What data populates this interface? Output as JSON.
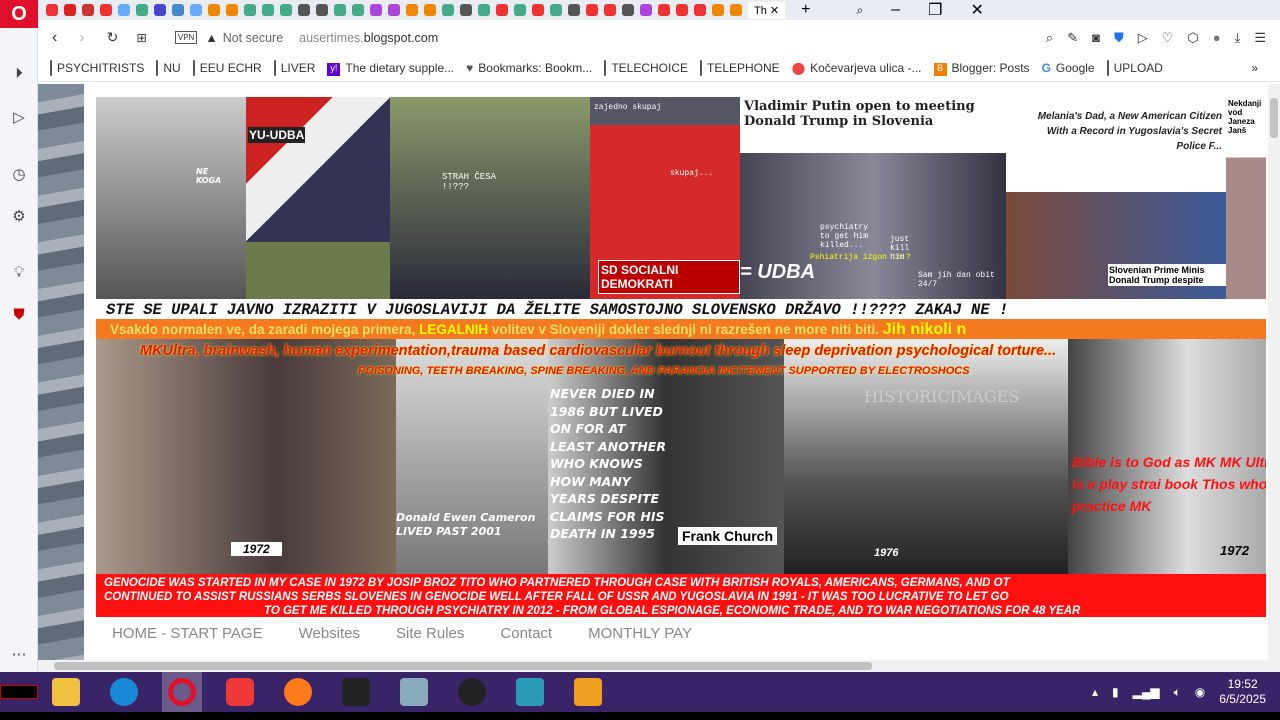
{
  "browser": {
    "url_prefix": "ausertimes.",
    "url_domain": "blogspot.com",
    "vpn": "VPN",
    "security": "Not secure",
    "tab_title": "Th"
  },
  "bookmarks": [
    {
      "label": "PSYCHITRISTS",
      "icon": "folder-icon"
    },
    {
      "label": "NU",
      "icon": "folder-icon"
    },
    {
      "label": "EEU ECHR",
      "icon": "folder-icon"
    },
    {
      "label": "LIVER",
      "icon": "folder-icon"
    },
    {
      "label": "The dietary supple...",
      "icon": "yahoo-icon"
    },
    {
      "label": "Bookmarks: Bookm...",
      "icon": "heart-icon"
    },
    {
      "label": "TELECHOICE",
      "icon": "folder-icon"
    },
    {
      "label": "TELEPHONE",
      "icon": "folder-icon"
    },
    {
      "label": "Kočevarjeva ulica -...",
      "icon": "maps-pin-icon"
    },
    {
      "label": "Blogger: Posts",
      "icon": "blogger-icon"
    },
    {
      "label": "Google",
      "icon": "google-icon"
    },
    {
      "label": "UPLOAD",
      "icon": "folder-icon"
    }
  ],
  "banner": {
    "top_captions": {
      "yu_udba": "YU-UDBA",
      "ne_koga": "NE KOGA",
      "strah": "STRAH ČESA !!???",
      "zajedno": "zajedno skupaj",
      "skupaj": "skupaj...",
      "sd": "SD SOCIALNI DEMOKRATI",
      "udba": "= UDBA",
      "psych": "psychiatry to get him killed...",
      "just": "just kill him",
      "psih": "Pshiatrija izgon !!!?",
      "samjih": "Sam jih dan obit 24/7"
    },
    "headline1": "Vladimir Putin open to meeting Donald Trump in Slovenia",
    "headline2": "Melania's Dad, a New American Citizen With a Record in Yugoslavia's Secret Police F...",
    "headline3": "Nekdanji vod Janeza Janš",
    "slovenian_pm": "Slovenian Prime Minis Donald Trump despite",
    "line1": "STE SE UPALI JAVNO IZRAZITI V JUGOSLAVIJI DA ŽELITE SAMOSTOJNO SLOVENSKO DRŽAVO !!???? ZAKAJ NE !",
    "line2a": "Vsakdo normalen ve, da zaradi mojega primera, ",
    "line2b": "LEGALNIH",
    "line2c": " volitev v Sloveniji dokler slednji ni razrešen ne more niti biti. ",
    "line2d": "Jih nikoli n",
    "line3": "MKUltra, brainwash, human experimentation,trauma based cardiovascular burnout through sleep deprivation psychological torture...",
    "line4": "POISONING, TEETH BREAKING, SPINE BREAKING, AND PARANOIA INCITEMENT SUPPORTED BY ELECTROSHOCS",
    "year1": "1972",
    "cameron": "Donald Ewen Cameron LIVED PAST 2001",
    "never_died": "NEVER DIED IN 1986 BUT LIVED ON FOR AT LEAST ANOTHER WHO KNOWS HOW MANY YEARS DESPITE CLAIMS FOR HIS DEATH IN 1995",
    "frank": "Frank Church",
    "historic": "HISTORICIMAGES",
    "year2": "1976",
    "bible": "Bible is to God as MK MK Ultra is a play strai book Thos who practice MK",
    "year3": "1972",
    "bottom1": "GENOCIDE WAS STARTED IN MY CASE IN 1972 BY JOSIP BROZ TITO WHO PARTNERED THROUGH CASE WITH BRITISH ROYALS, AMERICANS, GERMANS, AND OT",
    "bottom2": "CONTINUED TO ASSIST RUSSIANS SERBS SLOVENES IN GENOCIDE WELL AFTER FALL OF USSR  AND YUGOSLAVIA IN 1991 - IT WAS TOO LUCRATIVE TO LET GO",
    "bottom3": "TO GET ME KILLED THROUGH PSYCHIATRY IN 2012 - FROM GLOBAL ESPIONAGE, ECONOMIC TRADE, AND TO WAR NEGOTIATIONS FOR 48 YEAR"
  },
  "nav": [
    "HOME - START PAGE",
    "Websites",
    "Site Rules",
    "Contact",
    "MONTHLY PAY"
  ],
  "taskbar": {
    "time": "19:52",
    "date": "6/5/2025"
  },
  "colors": {
    "opera_red": "#e0102a",
    "banner_red": "#ff1010",
    "orange_bar": "#f47a20",
    "taskbar": "#3a2468"
  }
}
